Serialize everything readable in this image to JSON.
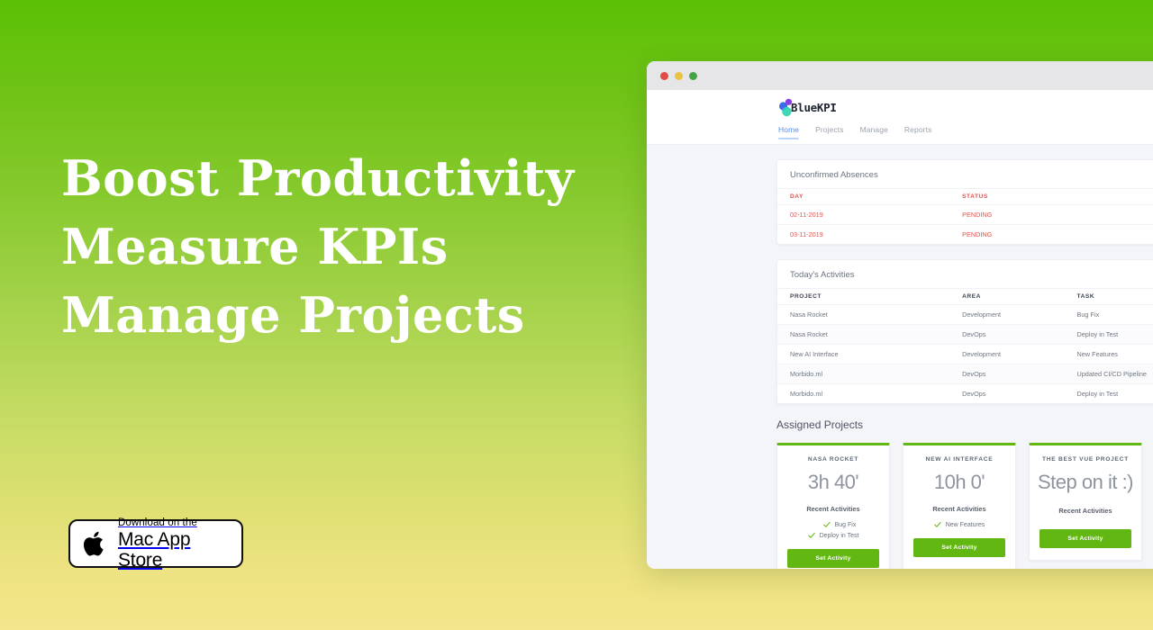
{
  "hero": {
    "lines": [
      "Boost Productivity",
      "Measure KPIs",
      "Manage Projects"
    ]
  },
  "badge": {
    "icon": "apple-logo-icon",
    "small_text": "Download on the",
    "big_text": "Mac App Store"
  },
  "window": {
    "traffic_lights": [
      "close-red",
      "minimize-yellow",
      "maximize-green"
    ],
    "brand": {
      "logo_icon": "bluekpi-circles-logo",
      "name": "BlueKPI"
    },
    "nav": [
      {
        "label": "Home",
        "active": true
      },
      {
        "label": "Projects",
        "active": false
      },
      {
        "label": "Manage",
        "active": false
      },
      {
        "label": "Reports",
        "active": false
      }
    ]
  },
  "absences": {
    "title": "Unconfirmed Absences",
    "headers": [
      "DAY",
      "STATUS"
    ],
    "rows": [
      {
        "day": "02-11-2019",
        "status": "PENDING"
      },
      {
        "day": "03-11-2019",
        "status": "PENDING"
      }
    ]
  },
  "activities": {
    "title": "Today's Activities",
    "headers": [
      "PROJECT",
      "AREA",
      "TASK"
    ],
    "rows": [
      {
        "project": "Nasa Rocket",
        "area": "Development",
        "task": "Bug Fix"
      },
      {
        "project": "Nasa Rocket",
        "area": "DevOps",
        "task": "Deploy in Test"
      },
      {
        "project": "New AI Interface",
        "area": "Development",
        "task": "New Features"
      },
      {
        "project": "Morbido.ml",
        "area": "DevOps",
        "task": "Updated CI/CD Pipeline"
      },
      {
        "project": "Morbido.ml",
        "area": "DevOps",
        "task": "Deploy in Test"
      }
    ]
  },
  "assigned": {
    "heading": "Assigned Projects",
    "cards": [
      {
        "title": "NASA ROCKET",
        "value": "3h 40'",
        "sub": "Recent Activities",
        "items": [
          "Bug Fix",
          "Deploy in Test"
        ],
        "button": "Set Activity"
      },
      {
        "title": "NEW AI INTERFACE",
        "value": "10h 0'",
        "sub": "Recent Activities",
        "items": [
          "New Features"
        ],
        "button": "Set Activity"
      },
      {
        "title": "THE BEST VUE PROJECT",
        "value": "Step on it :)",
        "sub": "Recent Activities",
        "items": [],
        "button": "Set Activity"
      }
    ]
  },
  "colors": {
    "bg_top": "#5cc005",
    "bg_bottom": "#f3e68b",
    "accent_green": "#62b712",
    "alert_red": "#e0534d",
    "nav_active": "#4f8ef7",
    "panel_bg": "#f4f5f9"
  }
}
